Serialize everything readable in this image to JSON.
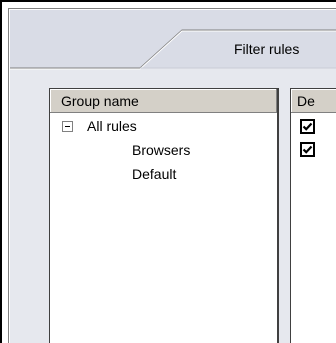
{
  "panel": {
    "title": "Filter rules"
  },
  "rules_list": {
    "header": "Group name",
    "root": {
      "label": "All rules",
      "expander_icon": "minus-box-icon",
      "children": [
        {
          "label": "Browsers"
        },
        {
          "label": "Default"
        }
      ]
    }
  },
  "enabled_column": {
    "header": "De",
    "rows": [
      {
        "checked": true
      },
      {
        "checked": true
      }
    ]
  },
  "colors": {
    "panel_bg": "#e6e8ee",
    "header_bg": "#d9dce6",
    "column_header_bg": "#d4d0c8"
  }
}
